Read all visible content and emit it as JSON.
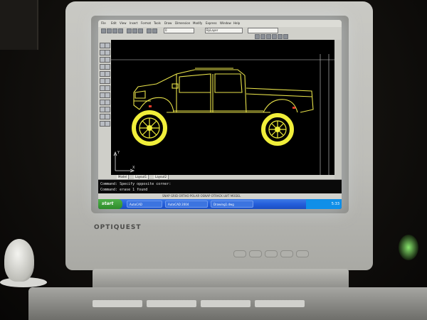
{
  "monitor": {
    "brand": "OPTIQUEST"
  },
  "app": {
    "menu": [
      "File",
      "Edit",
      "View",
      "Insert",
      "Format",
      "Tools",
      "Draw",
      "Dimension",
      "Modify",
      "Express",
      "Window",
      "Help"
    ],
    "layer_combo": "0",
    "style_combo": "ByLayer",
    "tabs": [
      "Model",
      "Layout1",
      "Layout2"
    ],
    "command_lines": [
      "Command:  Specify opposite corner:",
      "Command:  erase 1 found"
    ],
    "status_text": "SNAP  GRID  ORTHO  POLAR  OSNAP  OTRACK  LWT  MODEL"
  },
  "taskbar": {
    "start_label": "start",
    "tasks": [
      "AutoCAD",
      "AutoCAD 2004",
      "Drawing1.dwg"
    ],
    "tray_text": "5:33"
  },
  "drawing": {
    "line_color": "#e8e24a",
    "wheel_color": "#f1ef3a",
    "accent_color": "#e23a2a",
    "ucs_x": "X",
    "ucs_y": "Y"
  }
}
